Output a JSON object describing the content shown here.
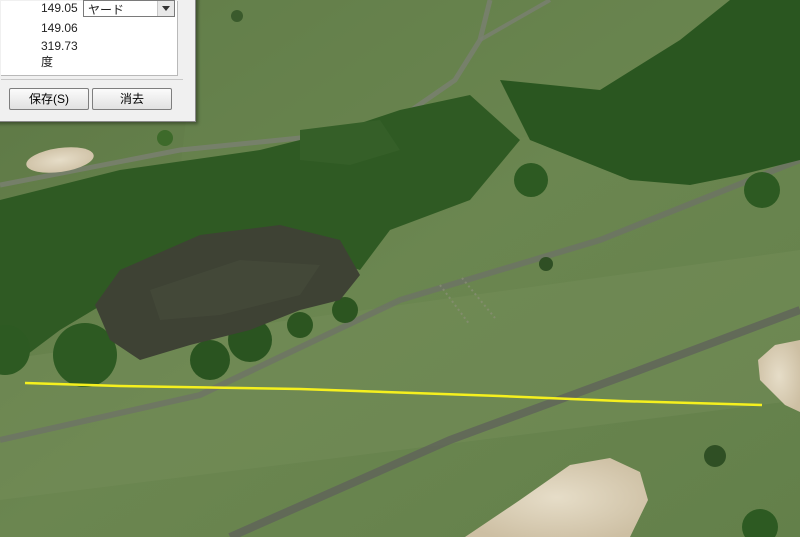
{
  "measure": {
    "length_value": "149.05",
    "unit_selected": "ヤード",
    "ground_length_value": "149.06",
    "heading_value": "319.73",
    "heading_unit": "度",
    "save_label": "保存(S)",
    "cancel_label": "消去"
  },
  "colors": {
    "path_line": "#f5f01e",
    "fairway": "#6b8650",
    "rough": "#5f7a46",
    "bunker_sand": "#d8cdb6",
    "pond_water": "#3e4234",
    "trees": "#2e5a22",
    "cart_path": "#6d7267"
  }
}
